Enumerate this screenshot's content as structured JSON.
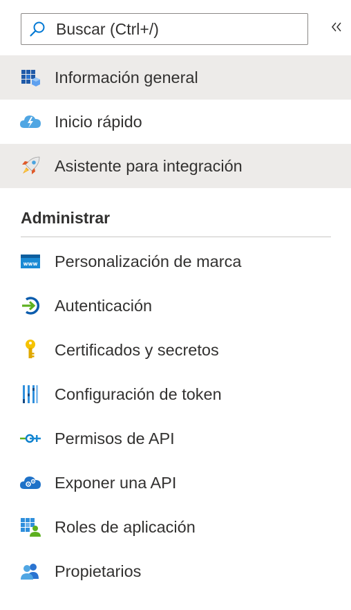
{
  "search": {
    "placeholder": "Buscar (Ctrl+/)"
  },
  "nav": [
    {
      "label": "Información general",
      "icon": "grid-overview-icon",
      "selected": true
    },
    {
      "label": "Inicio rápido",
      "icon": "cloud-lightning-icon",
      "selected": false
    },
    {
      "label": "Asistente para integración",
      "icon": "rocket-icon",
      "selected": true
    }
  ],
  "section": {
    "title": "Administrar"
  },
  "manage": [
    {
      "label": "Personalización de marca",
      "icon": "www-window-icon"
    },
    {
      "label": "Autenticación",
      "icon": "sign-in-arrow-icon"
    },
    {
      "label": "Certificados y secretos",
      "icon": "key-icon"
    },
    {
      "label": "Configuración de token",
      "icon": "token-bars-icon"
    },
    {
      "label": "Permisos de API",
      "icon": "api-connector-icon"
    },
    {
      "label": "Exponer una API",
      "icon": "cloud-gear-icon"
    },
    {
      "label": "Roles de aplicación",
      "icon": "grid-user-icon"
    },
    {
      "label": "Propietarios",
      "icon": "users-icon"
    }
  ],
  "colors": {
    "selected_bg": "#edebe9",
    "accent": "#0078d4",
    "text": "#323130"
  }
}
